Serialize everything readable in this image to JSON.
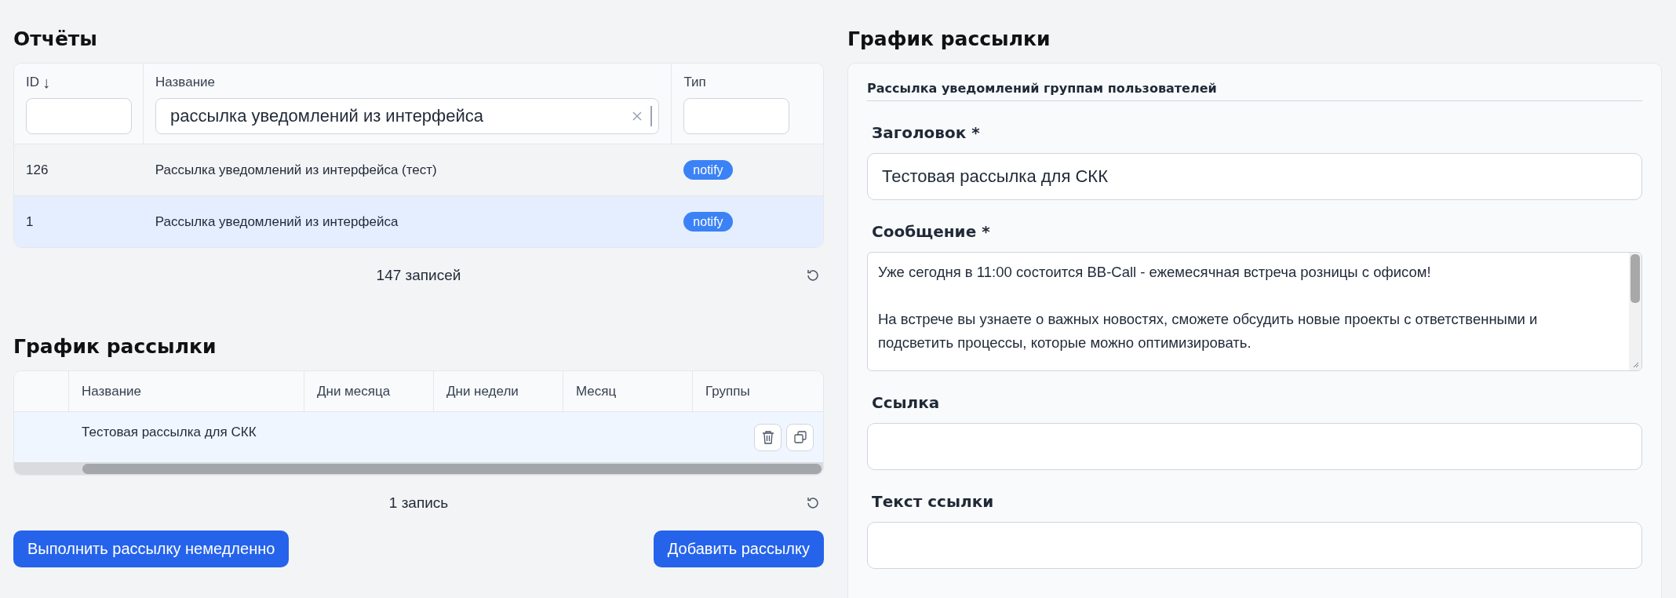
{
  "reports": {
    "title": "Отчёты",
    "columns": [
      {
        "label": "ID",
        "sort_icon": "↓"
      },
      {
        "label": "Название",
        "filter_value": "рассылка уведомлений из интерфейса"
      },
      {
        "label": "Тип"
      }
    ],
    "rows": [
      {
        "id": "126",
        "name": "Рассылка уведомлений из интерфейса (тест)",
        "type": "notify",
        "selected": false
      },
      {
        "id": "1",
        "name": "Рассылка уведомлений из интерфейса",
        "type": "notify",
        "selected": true
      }
    ],
    "count": "147 записей"
  },
  "schedule": {
    "title": "График рассылки",
    "columns": [
      "Название",
      "Дни месяца",
      "Дни недели",
      "Месяц",
      "Группы"
    ],
    "rows": [
      {
        "name": "Тестовая рассылка для СКК",
        "selected": true
      }
    ],
    "count": "1 запись"
  },
  "buttons": [
    {
      "label": "Выполнить рассылку немедленно"
    },
    {
      "label": "Добавить рассылку"
    }
  ],
  "editor": {
    "title": "График рассылки",
    "panel_title": "Рассылка уведомлений группам пользователей",
    "fields": [
      {
        "label": "Заголовок *",
        "kind": "input",
        "value": "Тестовая рассылка для СКК"
      },
      {
        "label": "Сообщение *",
        "kind": "textarea",
        "value": "Уже сегодня в 11:00 состоится BB-Call - ежемесячная встреча розницы с офисом!\n\nНа встрече вы узнаете о важных новостях, сможете обсудить новые проекты с ответственными и подсветить процессы, которые можно оптимизировать."
      },
      {
        "label": "Ссылка",
        "kind": "input"
      },
      {
        "label": "Текст ссылки",
        "kind": "input"
      }
    ]
  }
}
